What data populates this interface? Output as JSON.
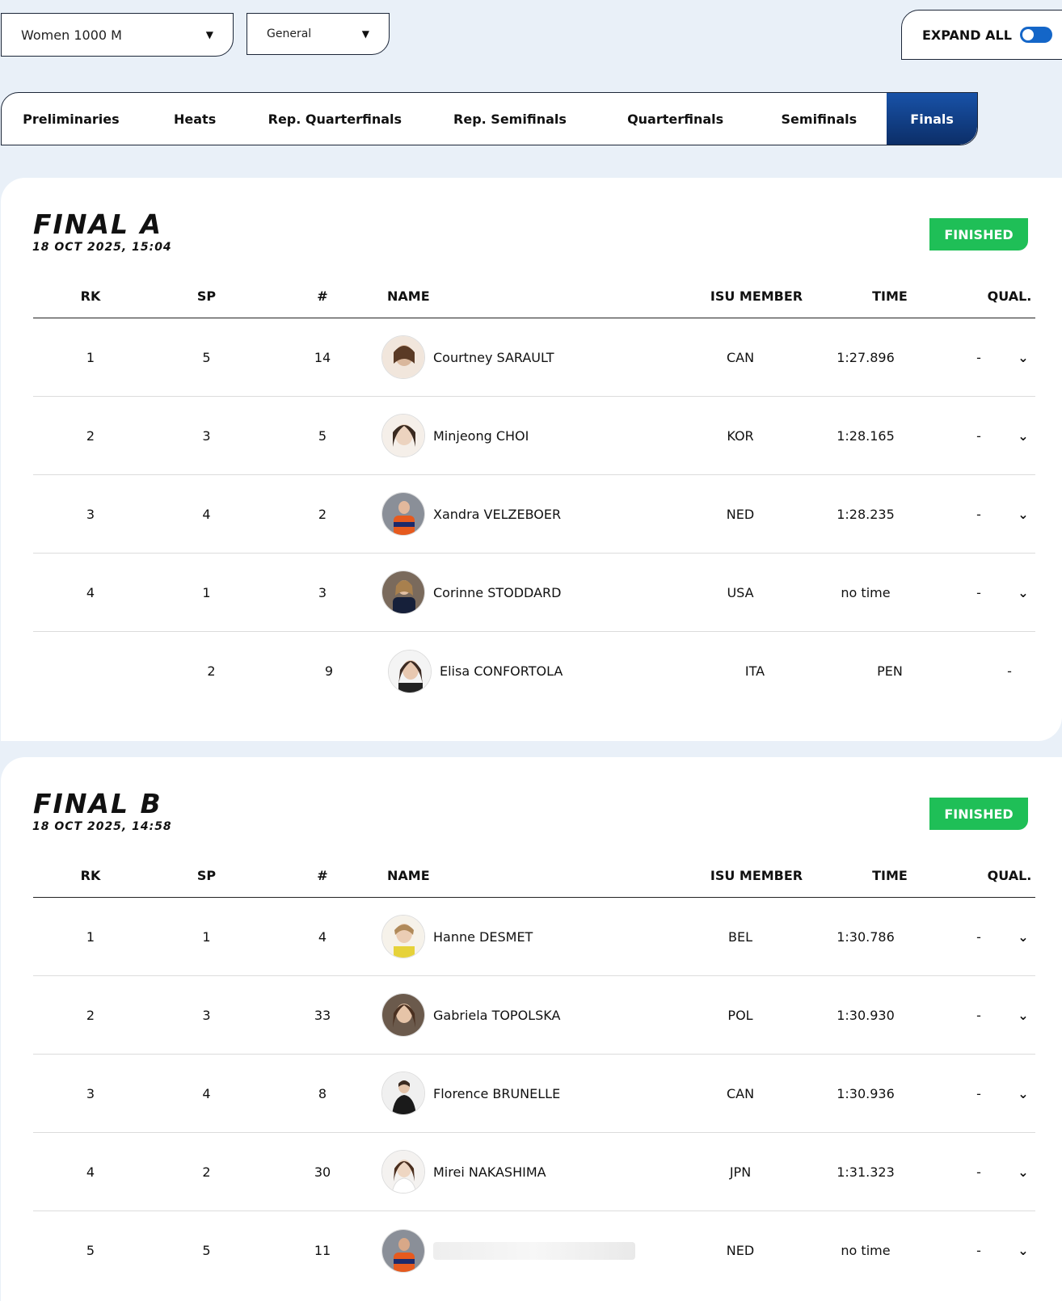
{
  "filters": {
    "event": "Women 1000 M",
    "type": "General",
    "expand_label": "EXPAND ALL"
  },
  "tabs": [
    {
      "label": "Preliminaries"
    },
    {
      "label": "Heats"
    },
    {
      "label": "Rep. Quarterfinals"
    },
    {
      "label": "Rep. Semifinals"
    },
    {
      "label": "Quarterfinals"
    },
    {
      "label": "Semifinals"
    },
    {
      "label": "Finals"
    }
  ],
  "columns": {
    "rk": "RK",
    "sp": "SP",
    "no": "#",
    "name": "NAME",
    "member": "ISU MEMBER",
    "time": "TIME",
    "qual": "QUAL."
  },
  "finals": [
    {
      "title": "FINAL A",
      "date": "18 OCT 2025, 15:04",
      "status": "FINISHED",
      "rows": [
        {
          "rk": "1",
          "sp": "5",
          "no": "14",
          "name": "Courtney SARAULT",
          "member": "CAN",
          "time": "1:27.896",
          "qual": "-"
        },
        {
          "rk": "2",
          "sp": "3",
          "no": "5",
          "name": "Minjeong CHOI",
          "member": "KOR",
          "time": "1:28.165",
          "qual": "-"
        },
        {
          "rk": "3",
          "sp": "4",
          "no": "2",
          "name": "Xandra VELZEBOER",
          "member": "NED",
          "time": "1:28.235",
          "qual": "-"
        },
        {
          "rk": "4",
          "sp": "1",
          "no": "3",
          "name": "Corinne STODDARD",
          "member": "USA",
          "time": "no time",
          "qual": "-"
        },
        {
          "rk": "",
          "sp": "2",
          "no": "9",
          "name": "Elisa CONFORTOLA",
          "member": "ITA",
          "time": "PEN",
          "qual": "-"
        }
      ]
    },
    {
      "title": "FINAL B",
      "date": "18 OCT 2025, 14:58",
      "status": "FINISHED",
      "rows": [
        {
          "rk": "1",
          "sp": "1",
          "no": "4",
          "name": "Hanne DESMET",
          "member": "BEL",
          "time": "1:30.786",
          "qual": "-"
        },
        {
          "rk": "2",
          "sp": "3",
          "no": "33",
          "name": "Gabriela TOPOLSKA",
          "member": "POL",
          "time": "1:30.930",
          "qual": "-"
        },
        {
          "rk": "3",
          "sp": "4",
          "no": "8",
          "name": "Florence BRUNELLE",
          "member": "CAN",
          "time": "1:30.936",
          "qual": "-"
        },
        {
          "rk": "4",
          "sp": "2",
          "no": "30",
          "name": "Mirei NAKASHIMA",
          "member": "JPN",
          "time": "1:31.323",
          "qual": "-"
        },
        {
          "rk": "5",
          "sp": "5",
          "no": "11",
          "name": "",
          "member": "NED",
          "time": "no time",
          "qual": "-"
        }
      ]
    }
  ],
  "colors": {
    "accent": "#1466c8",
    "active_tab": "#0c2e68",
    "finished": "#1fbf57",
    "background": "#e9f0f8"
  }
}
